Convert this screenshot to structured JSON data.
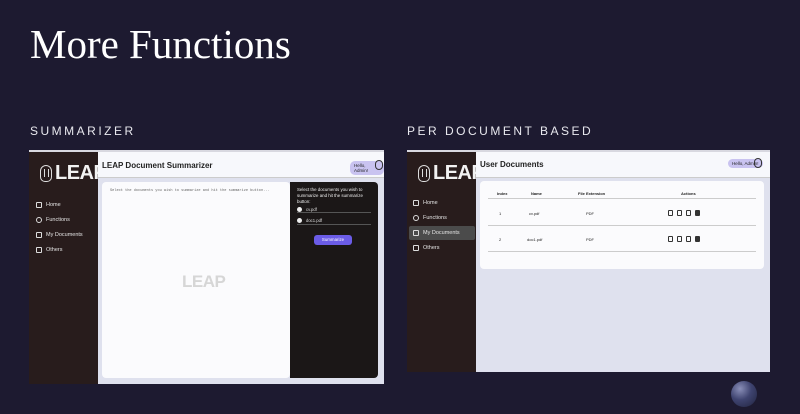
{
  "slide": {
    "title": "More Functions",
    "left_label": "SUMMARIZER",
    "right_label": "PER DOCUMENT BASED"
  },
  "summarizer": {
    "logo_text": "LEAP",
    "header_title": "LEAP Document Summarizer",
    "greeting": "Hello, Admin!",
    "nav": [
      {
        "label": "Home",
        "icon": "home-icon"
      },
      {
        "label": "Functions",
        "icon": "settings-icon"
      },
      {
        "label": "My Documents",
        "icon": "folder-icon"
      },
      {
        "label": "Others",
        "icon": "document-icon"
      }
    ],
    "placeholder": "Select the documents you wish to summarize and hit the summarize button...",
    "watermark": "LEAP",
    "instructions": "Select the documents you wish to summarize and hit the summarize button:",
    "documents": [
      "cv.pdf",
      "doc1.pdf"
    ],
    "button": "Summarize"
  },
  "user_documents": {
    "logo_text": "LEAP",
    "header_title": "User Documents",
    "greeting": "Hello, Admin!",
    "nav": [
      {
        "label": "Home",
        "icon": "home-icon"
      },
      {
        "label": "Functions",
        "icon": "settings-icon"
      },
      {
        "label": "My Documents",
        "icon": "folder-icon"
      },
      {
        "label": "Others",
        "icon": "document-icon"
      }
    ],
    "active_nav": "My Documents",
    "columns": [
      "Index",
      "Name",
      "File Extension",
      "Actions"
    ],
    "rows": [
      {
        "index": "1",
        "name": "cv.pdf",
        "ext": "PDF"
      },
      {
        "index": "2",
        "name": "doc1.pdf",
        "ext": "PDF"
      }
    ]
  }
}
